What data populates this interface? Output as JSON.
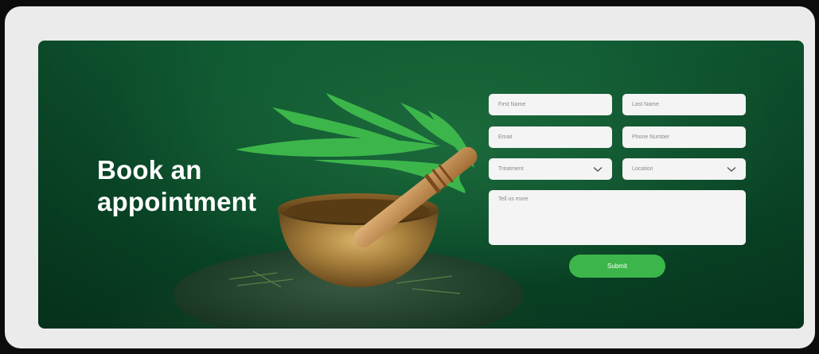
{
  "heading": {
    "line1": "Book an",
    "line2": "appointment"
  },
  "form": {
    "first_name_placeholder": "First Name",
    "last_name_placeholder": "Last Name",
    "email_placeholder": "Email",
    "phone_placeholder": "Phone Number",
    "treatment_label": "Treatment",
    "location_label": "Location",
    "message_placeholder": "Tell us more",
    "submit_label": "Submit"
  },
  "colors": {
    "background_green": "#0a4a29",
    "leaf_green": "#3cb64a",
    "button_green": "#3cb64a",
    "field_bg": "#f4f4f4",
    "heading_text": "#ffffff"
  },
  "icons": {
    "dropdown": "chevron-down-icon",
    "hero_image": "singing-bowl-with-mallet",
    "decoration": "green-leaf-swoosh"
  }
}
